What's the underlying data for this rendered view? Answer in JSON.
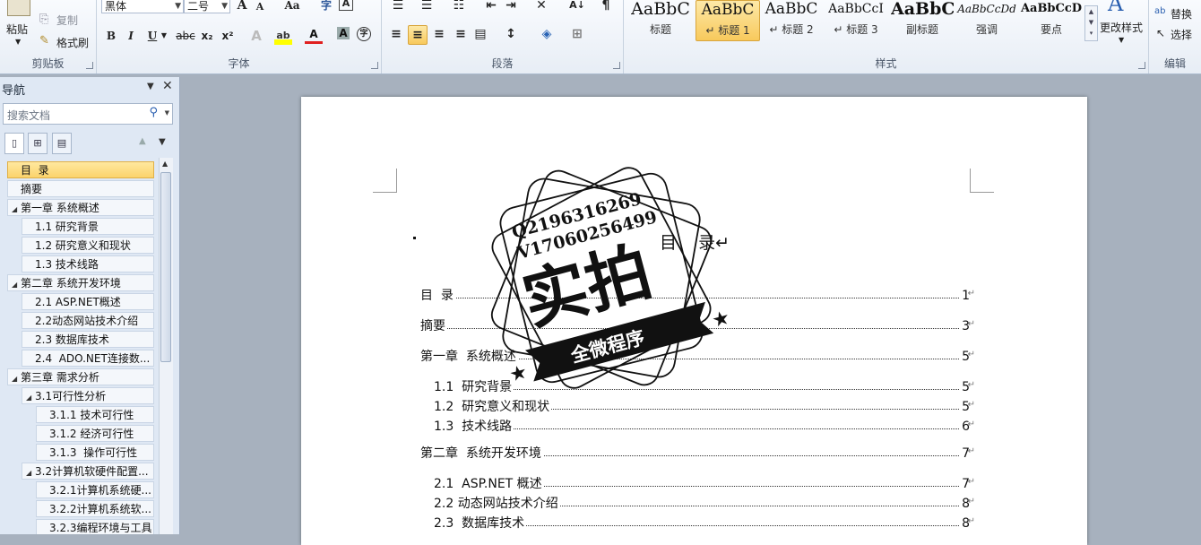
{
  "ribbon": {
    "clipboard": {
      "paste": "粘贴",
      "copy": "复制",
      "format_painter": "格式刷",
      "label": "剪贴板"
    },
    "font": {
      "name": "黑体",
      "size": "二号",
      "label": "字体",
      "grow": "A",
      "shrink": "A",
      "case": "Aa",
      "clear": "A"
    },
    "paragraph": {
      "label": "段落"
    },
    "styles": {
      "label": "样式",
      "items": [
        {
          "sample": "AaBbC",
          "name": "标题"
        },
        {
          "sample": "AaBbC",
          "name": "↵ 标题 1"
        },
        {
          "sample": "AaBbC",
          "name": "↵ 标题 2"
        },
        {
          "sample": "AaBbCcI",
          "name": "↵ 标题 3"
        },
        {
          "sample": "AaBbC",
          "name": "副标题"
        },
        {
          "sample": "AaBbCcDd",
          "name": "强调"
        },
        {
          "sample": "AaBbCcD",
          "name": "要点"
        }
      ],
      "change": "更改样式"
    },
    "editing": {
      "replace": "替换",
      "select": "选择",
      "label": "编辑"
    }
  },
  "nav": {
    "title": "导航",
    "search_placeholder": "搜索文档",
    "items": [
      {
        "label": "目  录",
        "level": 0,
        "active": true,
        "collapsible": false
      },
      {
        "label": "摘要",
        "level": 0,
        "active": false,
        "collapsible": false
      },
      {
        "label": "第一章 系统概述",
        "level": 0,
        "active": false,
        "collapsible": true
      },
      {
        "label": "1.1 研究背景",
        "level": 1,
        "active": false,
        "collapsible": false
      },
      {
        "label": "1.2 研究意义和现状",
        "level": 1,
        "active": false,
        "collapsible": false
      },
      {
        "label": "1.3 技术线路",
        "level": 1,
        "active": false,
        "collapsible": false
      },
      {
        "label": "第二章 系统开发环境",
        "level": 0,
        "active": false,
        "collapsible": true
      },
      {
        "label": "2.1 ASP.NET概述",
        "level": 1,
        "active": false,
        "collapsible": false
      },
      {
        "label": "2.2动态网站技术介绍",
        "level": 1,
        "active": false,
        "collapsible": false
      },
      {
        "label": "2.3 数据库技术",
        "level": 1,
        "active": false,
        "collapsible": false
      },
      {
        "label": "2.4  ADO.NET连接数...",
        "level": 1,
        "active": false,
        "collapsible": false
      },
      {
        "label": "第三章 需求分析",
        "level": 0,
        "active": false,
        "collapsible": true
      },
      {
        "label": "3.1可行性分析",
        "level": 1,
        "active": false,
        "collapsible": true
      },
      {
        "label": "3.1.1 技术可行性",
        "level": 2,
        "active": false,
        "collapsible": false
      },
      {
        "label": "3.1.2 经济可行性",
        "level": 2,
        "active": false,
        "collapsible": false
      },
      {
        "label": "3.1.3  操作可行性",
        "level": 2,
        "active": false,
        "collapsible": false
      },
      {
        "label": "3.2计算机软硬件配置...",
        "level": 1,
        "active": false,
        "collapsible": true
      },
      {
        "label": "3.2.1计算机系统硬...",
        "level": 2,
        "active": false,
        "collapsible": false
      },
      {
        "label": "3.2.2计算机系统软...",
        "level": 2,
        "active": false,
        "collapsible": false
      },
      {
        "label": "3.2.3编程环境与工具",
        "level": 2,
        "active": false,
        "collapsible": false
      }
    ]
  },
  "document": {
    "heading": "目    录↵",
    "toc": [
      {
        "title": "目  录",
        "page": "1",
        "indent": 0,
        "gap": 0
      },
      {
        "title": "摘要",
        "page": "3",
        "indent": 0,
        "gap": 12
      },
      {
        "title": "第一章  系统概述",
        "page": "5",
        "indent": 0,
        "gap": 12
      },
      {
        "title": "1.1  研究背景",
        "page": "5",
        "indent": 1,
        "gap": 12
      },
      {
        "title": "1.2  研究意义和现状",
        "page": "5",
        "indent": 1,
        "gap": 0
      },
      {
        "title": "1.3  技术线路",
        "page": "6",
        "indent": 1,
        "gap": 0
      },
      {
        "title": "第二章  系统开发环境",
        "page": "7",
        "indent": 0,
        "gap": 8
      },
      {
        "title": "2.1  ASP.NET 概述",
        "page": "7",
        "indent": 1,
        "gap": 12
      },
      {
        "title": "2.2 动态网站技术介绍",
        "page": "8",
        "indent": 1,
        "gap": 0
      },
      {
        "title": "2.3  数据库技术",
        "page": "8",
        "indent": 1,
        "gap": 0
      }
    ],
    "para_mark": "↵"
  },
  "watermark": {
    "line1": "Q2196316269",
    "line2": "V17060256499",
    "big": "实拍",
    "banner": "全微程序"
  }
}
